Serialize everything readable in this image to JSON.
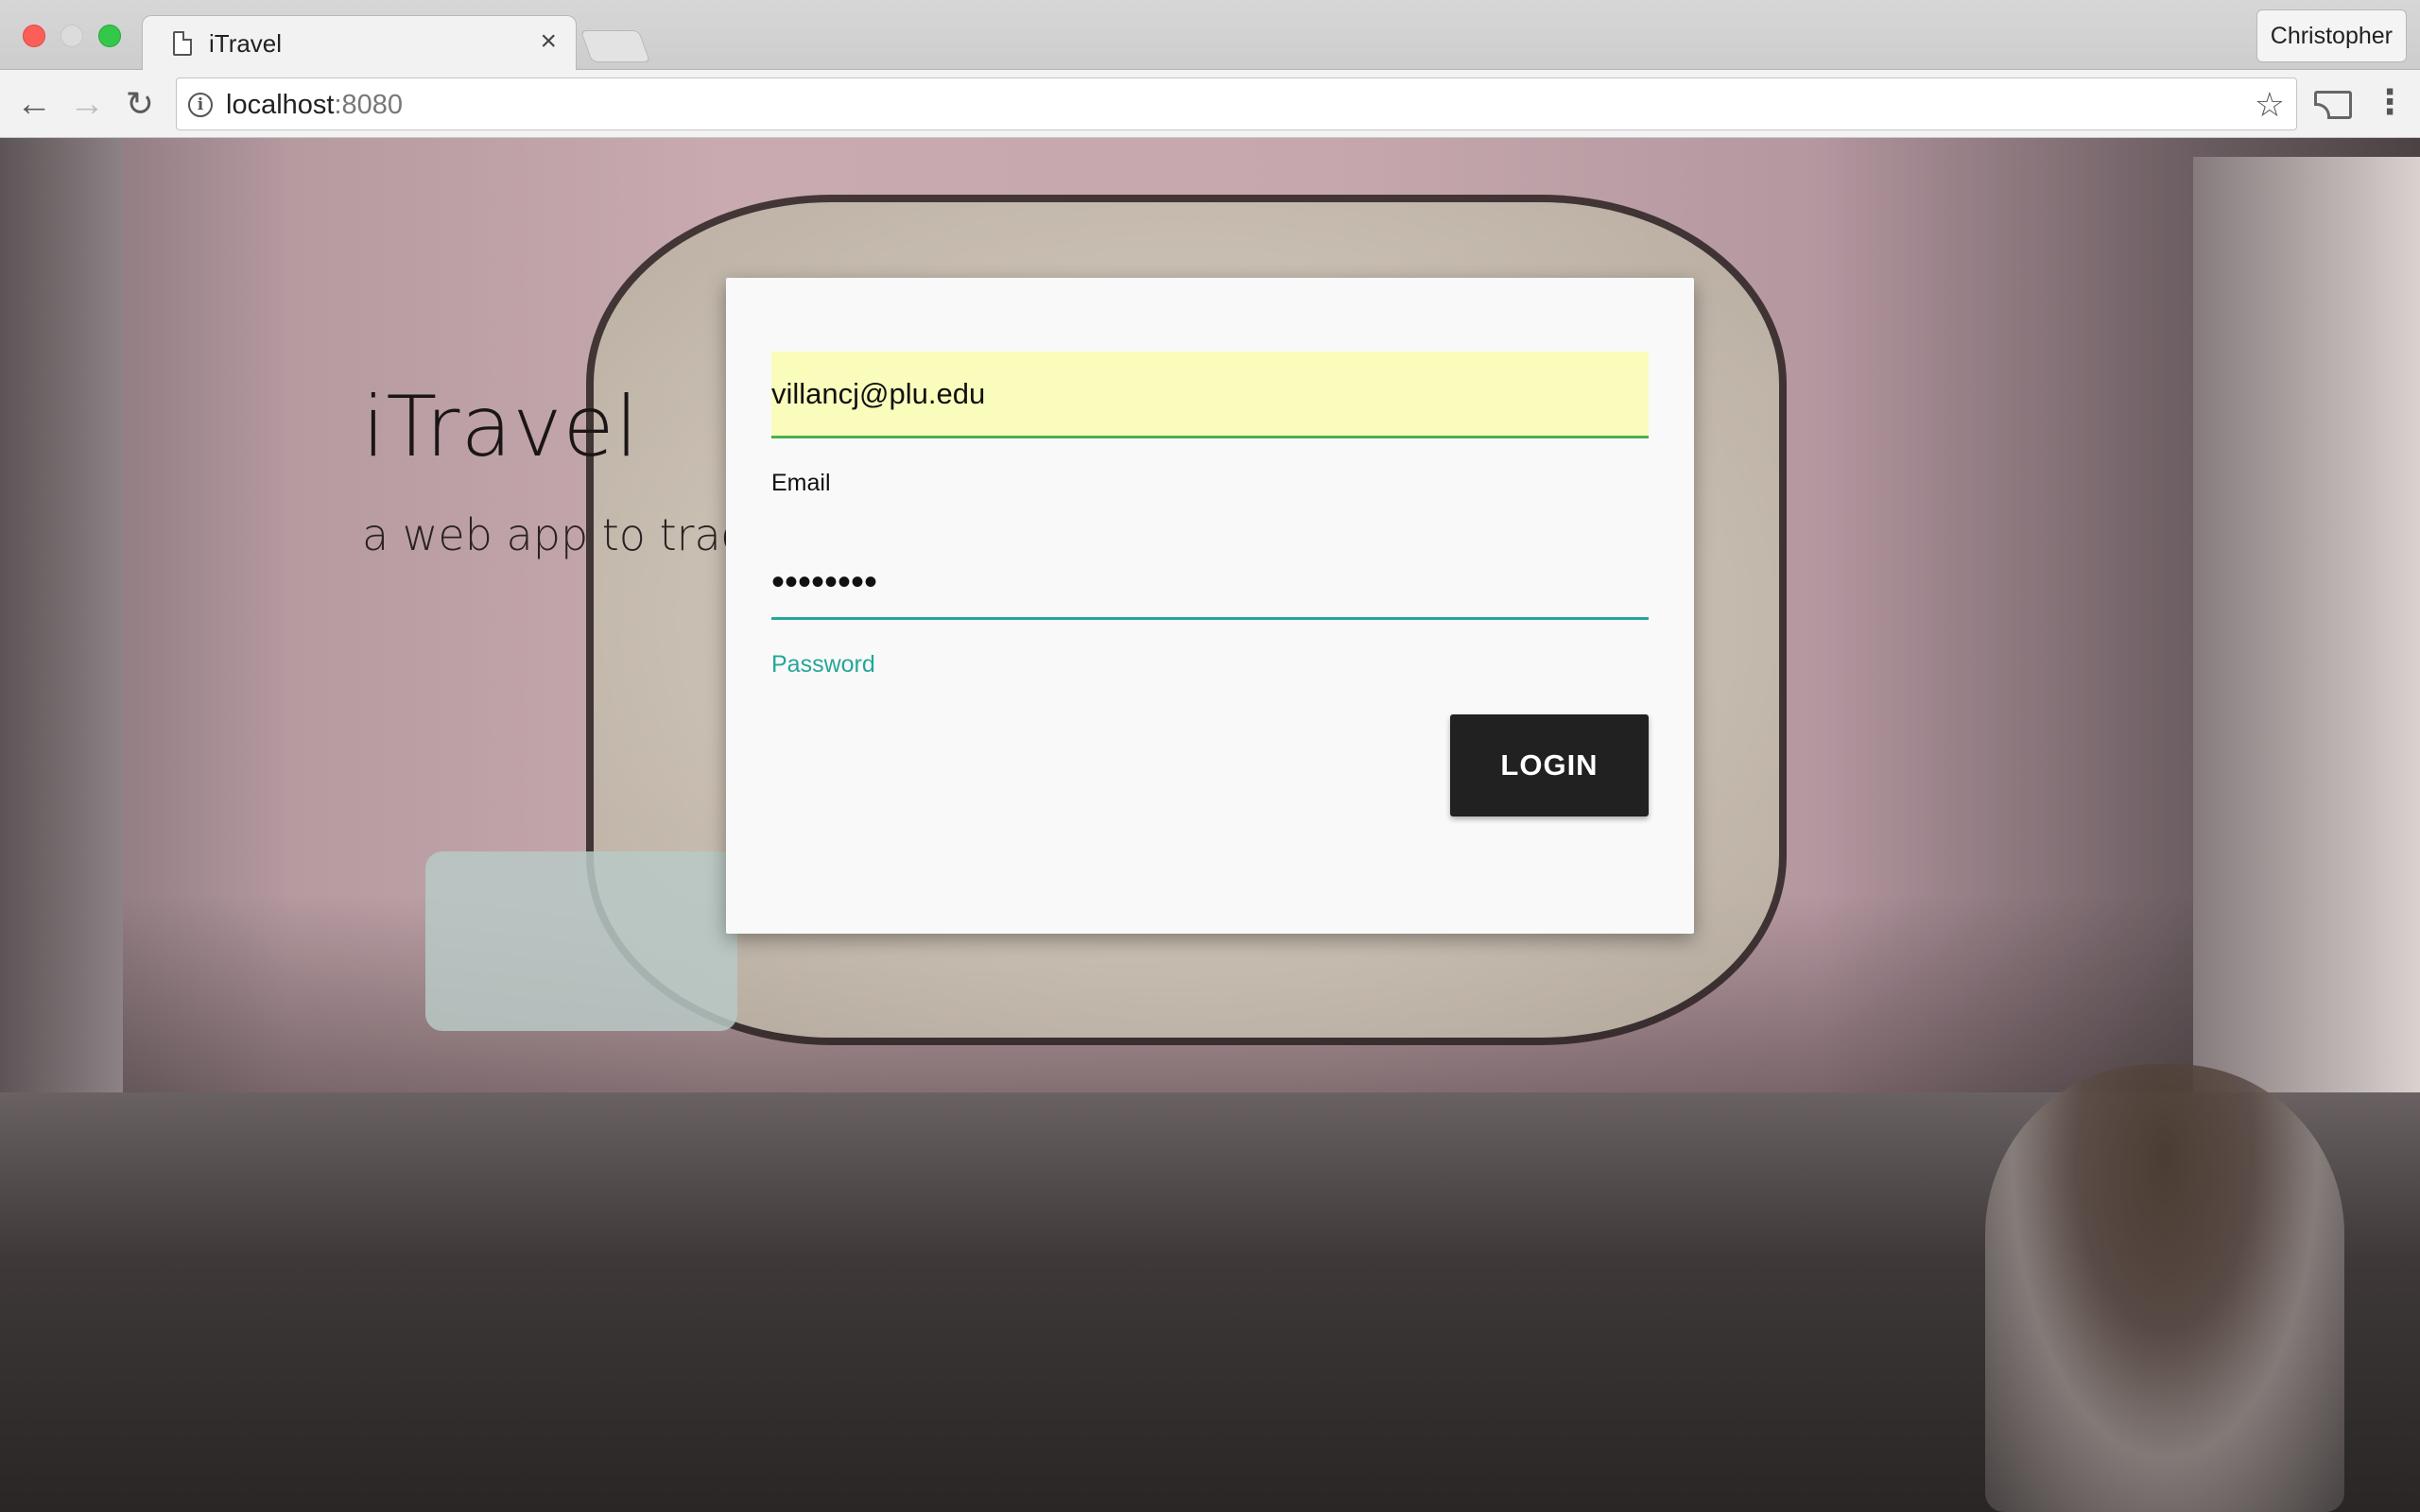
{
  "browser": {
    "tab_title": "iTravel",
    "tab_close": "×",
    "profile_name": "Christopher",
    "url_host": "localhost",
    "url_port": ":8080",
    "info_glyph": "i",
    "back_glyph": "←",
    "forward_glyph": "→",
    "reload_glyph": "↻",
    "star_glyph": "☆",
    "menu_glyph": "⋮"
  },
  "hero": {
    "title": "iTravel",
    "subtitle": "a web app to track"
  },
  "login_form": {
    "email_label": "Email",
    "email_value": "villancj@plu.edu",
    "password_label": "Password",
    "password_value": "••••••••",
    "submit_label": "LOGIN"
  },
  "colors": {
    "accent_teal": "#26a69a",
    "email_underline": "#4caf50",
    "autofill_bg": "#fafcbc",
    "button_bg": "#212121"
  }
}
